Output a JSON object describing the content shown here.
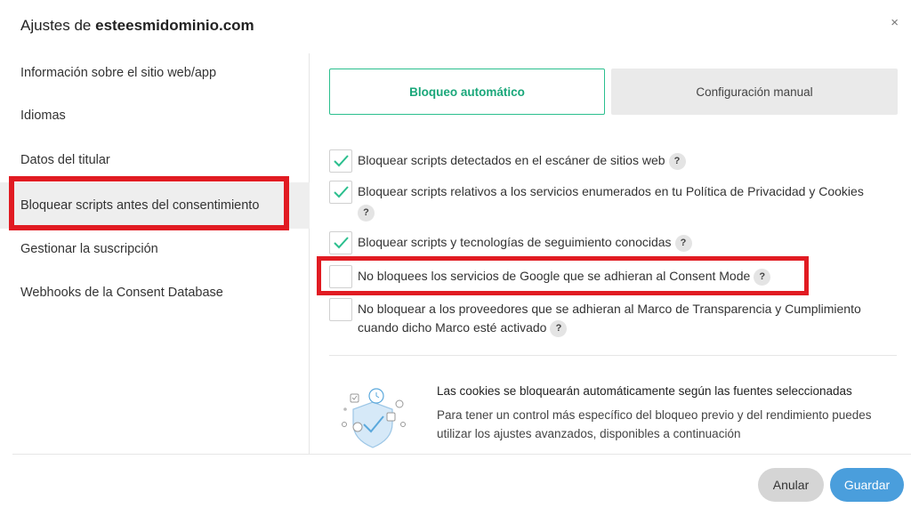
{
  "header": {
    "title_prefix": "Ajustes de ",
    "domain": "esteesmidominio.com",
    "close": "×"
  },
  "sidebar": {
    "items": [
      {
        "label": "Información sobre el sitio web/app"
      },
      {
        "label": "Idiomas"
      },
      {
        "label": "Datos del titular"
      },
      {
        "label": "Bloquear scripts antes del consentimiento",
        "active": true
      },
      {
        "label": "Gestionar la suscripción"
      },
      {
        "label": "Webhooks de la Consent Database"
      }
    ]
  },
  "tabs": {
    "auto": "Bloqueo automático",
    "manual": "Configuración manual"
  },
  "options": [
    {
      "label": "Bloquear scripts detectados en el escáner de sitios web",
      "checked": true
    },
    {
      "label": "Bloquear scripts relativos a los servicios enumerados en tu Política de Privacidad y Cookies",
      "checked": true
    },
    {
      "label": "Bloquear scripts y tecnologías de seguimiento conocidas",
      "checked": true
    },
    {
      "label": "No bloquees los servicios de Google que se adhieran al Consent Mode",
      "checked": false
    },
    {
      "label": "No bloquear a los proveedores que se adhieran al Marco de Transparencia y Cumplimiento cuando dicho Marco esté activado",
      "checked": false
    }
  ],
  "help_glyph": "?",
  "info": {
    "title": "Las cookies se bloquearán automáticamente según las fuentes seleccionadas",
    "body": "Para tener un control más específico del bloqueo previo y del rendimiento puedes utilizar los ajustes avanzados, disponibles a continuación"
  },
  "footer": {
    "cancel": "Anular",
    "save": "Guardar"
  },
  "colors": {
    "accent_green": "#2bbf8e",
    "highlight_red": "#e11b22",
    "save_blue": "#4a9edc"
  }
}
